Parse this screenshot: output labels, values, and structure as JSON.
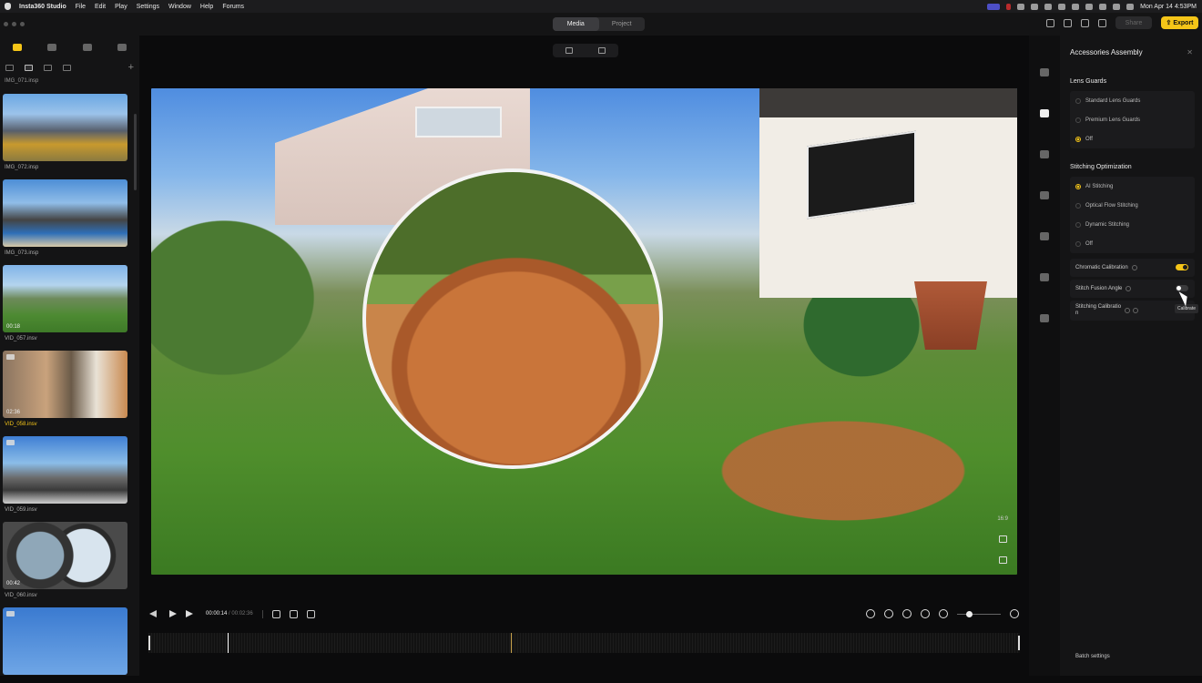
{
  "menubar": {
    "app_name": "Insta360 Studio",
    "items": [
      "File",
      "Edit",
      "Play",
      "Settings",
      "Window",
      "Help",
      "Forums"
    ],
    "clock": "Mon Apr 14  4:53PM"
  },
  "titlebar": {
    "tabs": [
      "Media",
      "Project"
    ],
    "active_tab": "Media",
    "share_label": "Share",
    "export_label": "Export"
  },
  "library": {
    "top_partial_name": "IMG_071.insp",
    "items": [
      {
        "name": "IMG_072.insp",
        "duration": "",
        "video": false,
        "selected": false
      },
      {
        "name": "IMG_073.insp",
        "duration": "",
        "video": false,
        "selected": false
      },
      {
        "name": "VID_057.insv",
        "duration": "00:18",
        "video": false,
        "selected": false
      },
      {
        "name": "VID_058.insv",
        "duration": "02:36",
        "video": true,
        "selected": true
      },
      {
        "name": "VID_059.insv",
        "duration": "",
        "video": true,
        "selected": false
      },
      {
        "name": "VID_060.insv",
        "duration": "00:42",
        "video": true,
        "selected": false
      },
      {
        "name": "",
        "duration": "",
        "video": true,
        "selected": false
      }
    ]
  },
  "player": {
    "aspect": "16:9",
    "current_time": "00:00:14",
    "total_time": "/ 00:02:36"
  },
  "panel": {
    "title": "Accessories Assembly",
    "lens_guards": {
      "title": "Lens Guards",
      "options": [
        "Standard Lens Guards",
        "Premium Lens Guards",
        "Off"
      ],
      "selected": "Off"
    },
    "stitching": {
      "title": "Stitching Optimization",
      "options": [
        "AI Stitching",
        "Optical Flow Stitching",
        "Dynamic Stitching",
        "Off"
      ],
      "selected": "AI Stitching"
    },
    "chromatic_calibration": {
      "label": "Chromatic Calibration",
      "on": true
    },
    "stitch_fusion_angle": {
      "label": "Stitch Fusion Angle",
      "on": false
    },
    "stitching_calibration": {
      "label": "Stitching Calibratio\nn"
    },
    "tooltip": "Calibrate",
    "batch_settings": "Batch settings"
  },
  "colors": {
    "accent": "#f5c518",
    "background": "#0b0b0c",
    "panel": "#141415"
  }
}
